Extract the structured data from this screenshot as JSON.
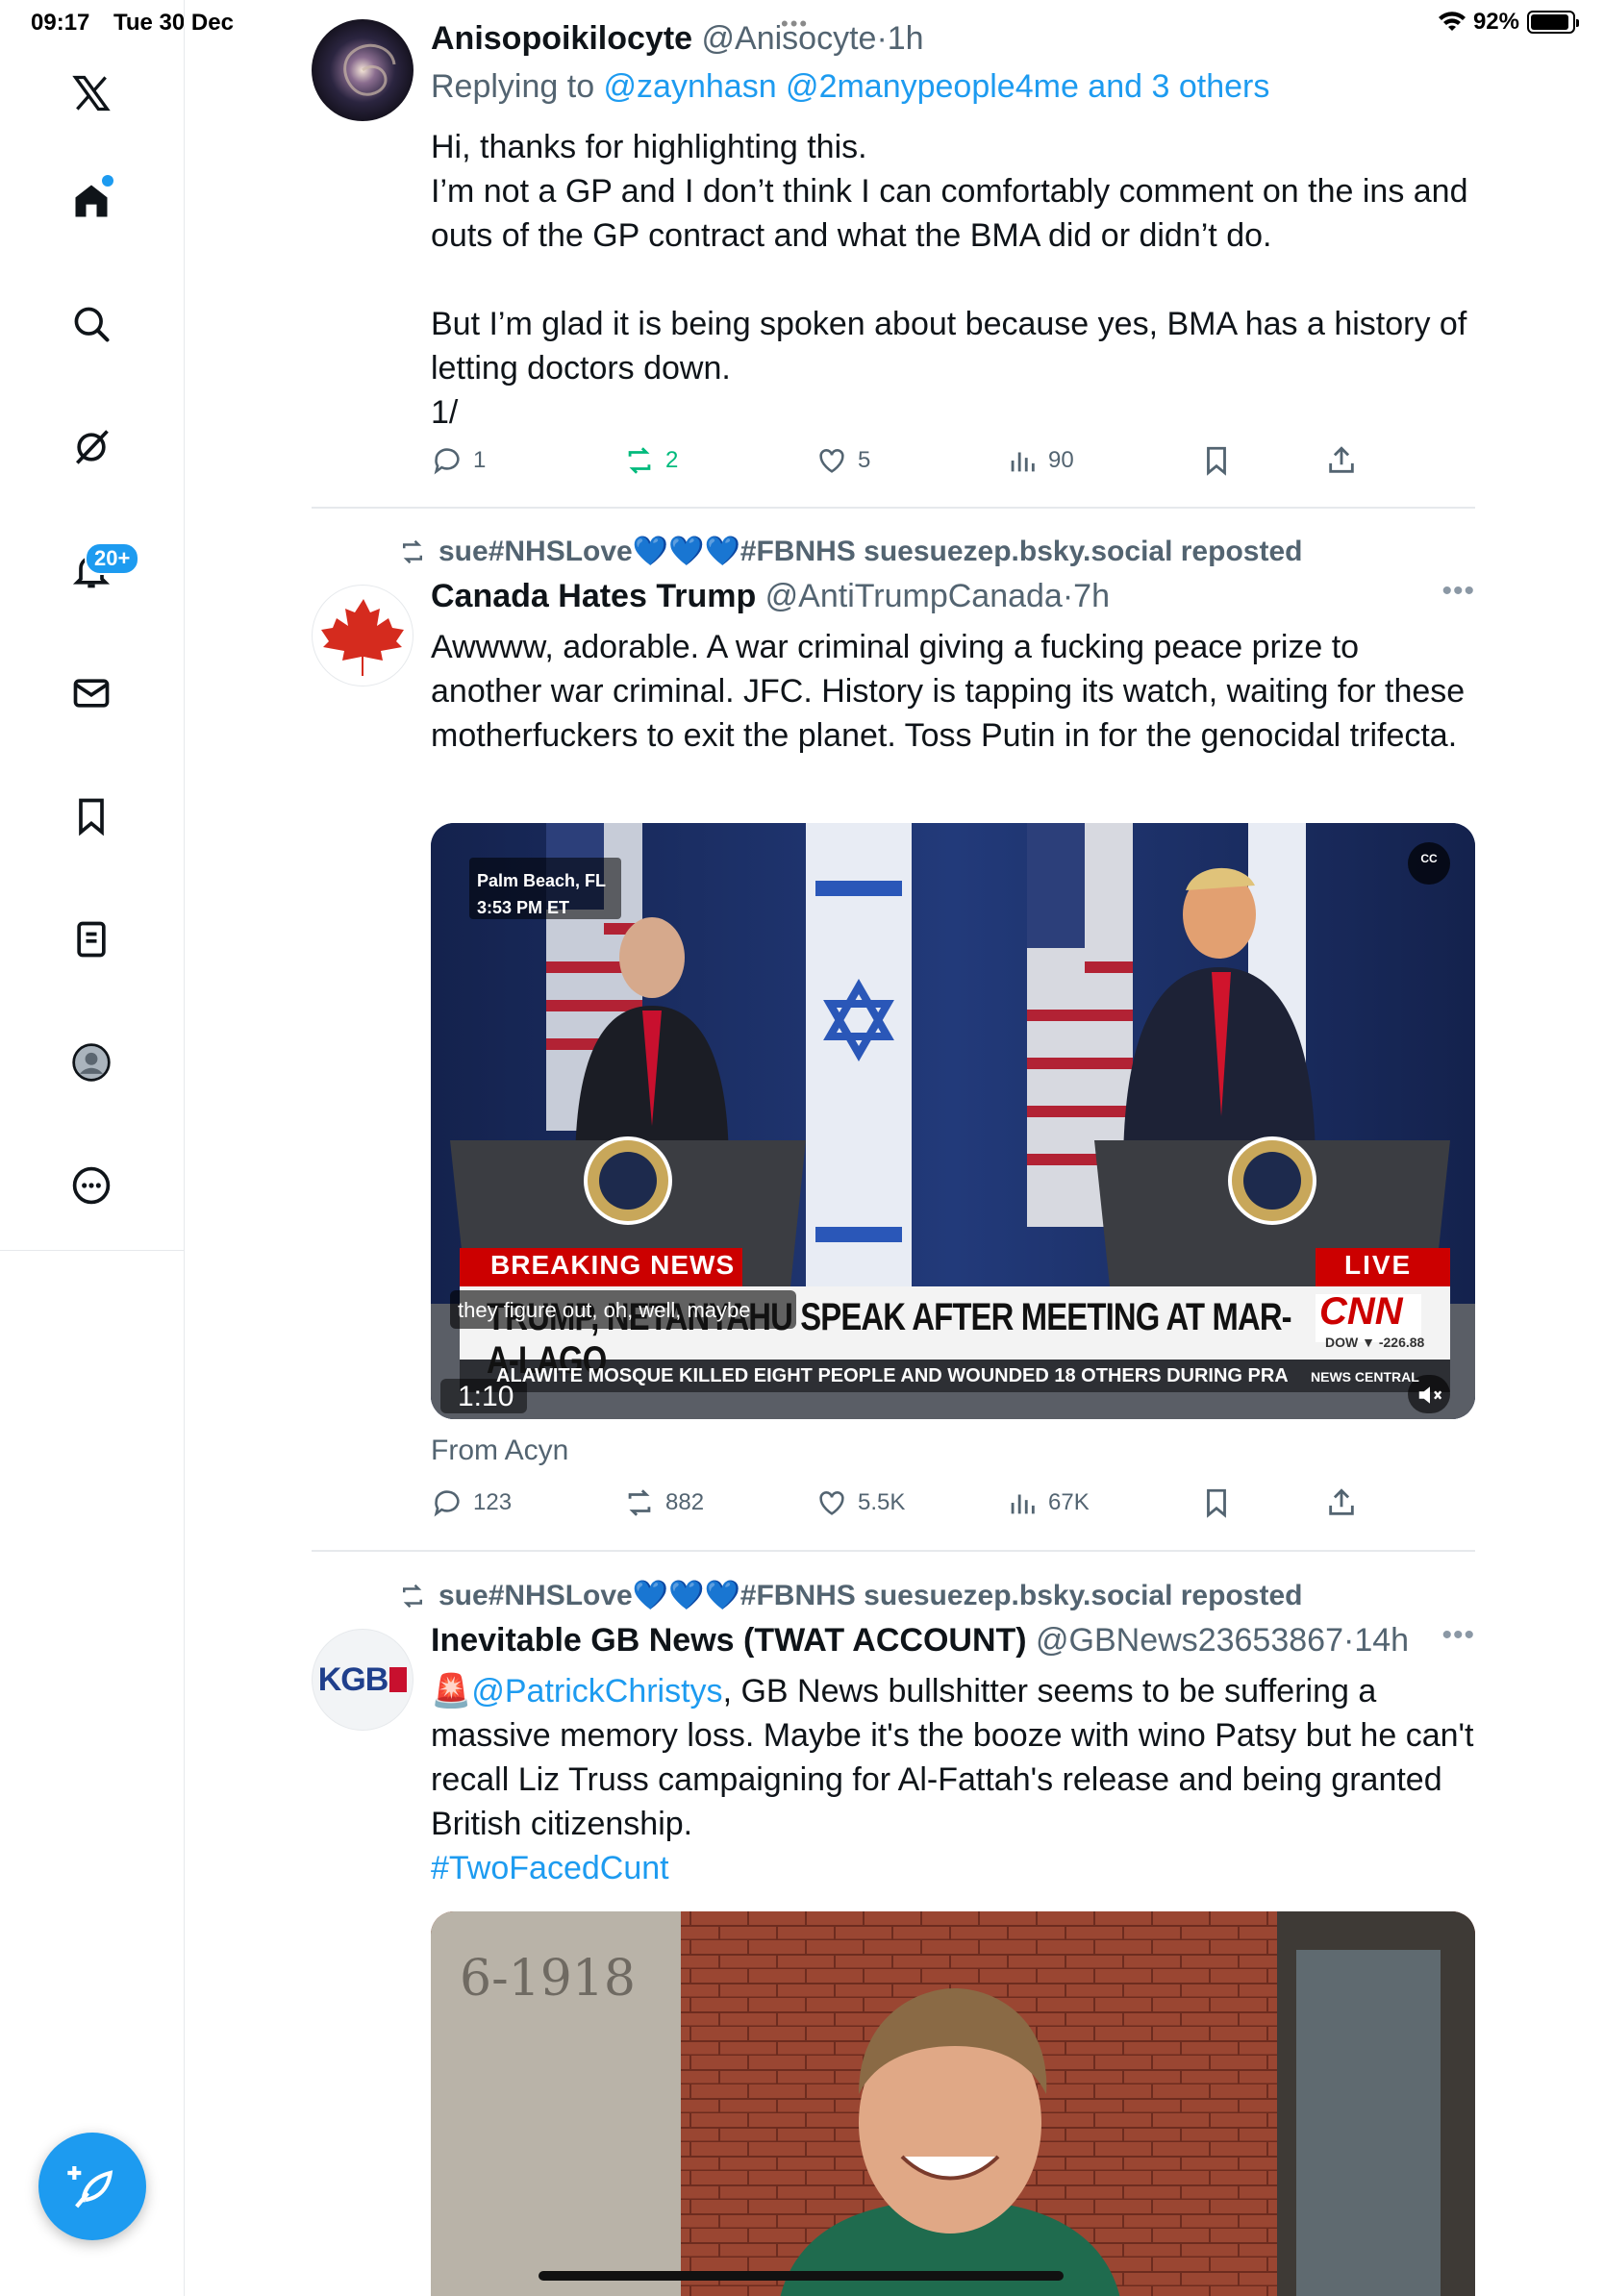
{
  "status_bar": {
    "time": "09:17",
    "date": "Tue 30 Dec",
    "battery": "92%"
  },
  "sidebar": {
    "items": [
      {
        "icon": "x-logo-icon"
      },
      {
        "icon": "home-icon"
      },
      {
        "icon": "search-icon"
      },
      {
        "icon": "grok-icon"
      },
      {
        "icon": "notifications-icon",
        "badge": "20+"
      },
      {
        "icon": "messages-icon"
      },
      {
        "icon": "bookmarks-icon"
      },
      {
        "icon": "lists-icon"
      },
      {
        "icon": "profile-icon"
      },
      {
        "icon": "more-icon"
      }
    ],
    "compose_icon": "compose-icon"
  },
  "tweets": [
    {
      "name": "Anisopoikilocyte",
      "handle": "@Anisocyte",
      "time": "1h",
      "replying_prefix": "Replying to ",
      "replying_to": "@zaynhasn @2manypeople4me and 3 others",
      "text": "Hi, thanks for highlighting this.\nI’m not a GP and I don’t think I can comfortably comment on the ins and outs of the GP contract and what the BMA did or didn’t do.\n\nBut I’m glad it is being spoken about because yes, BMA has a history of letting doctors down.\n1/",
      "replies": "1",
      "reposts": "2",
      "likes": "5",
      "views": "90"
    },
    {
      "repost_by": "sue#NHSLove💙💙💙#FBNHS suesuezep.bsky.social reposted",
      "name": "Canada Hates Trump",
      "handle": "@AntiTrumpCanada",
      "time": "7h",
      "text": "Awwww, adorable. A war criminal giving a fucking peace prize to another war criminal. JFC. History is tapping its watch, waiting for these motherfuckers to exit the planet.  Toss Putin in for the genocidal trifecta.",
      "video": {
        "location": "Palm Beach, FL",
        "clock": "3:53 PM ET",
        "breaking": "BREAKING NEWS",
        "live": "LIVE",
        "headline": "TRUMP, NETANYAHU SPEAK AFTER MEETING AT MAR-A-LAGO",
        "network": "CNN",
        "dow": "DOW ▼ -226.88",
        "ticker": "ALAWITE MOSQUE KILLED EIGHT PEOPLE AND WOUNDED 18 OTHERS DURING PRA",
        "ticker_tag": "NEWS CENTRAL",
        "caption": "they figure out, oh, well, maybe",
        "duration": "1:10",
        "cc": "CC"
      },
      "from": "From Acyn",
      "replies": "123",
      "reposts": "882",
      "likes": "5.5K",
      "views": "67K"
    },
    {
      "repost_by": "sue#NHSLove💙💙💙#FBNHS suesuezep.bsky.social reposted",
      "name": "Inevitable GB News (TWAT ACCOUNT)",
      "handle": "@GBNews23653867",
      "time": "14h",
      "avatar_text": "KGB",
      "mention_emoji": "🚨",
      "mention": "@PatrickChristys",
      "text": ", GB News bullshitter seems to be suffering a massive memory loss. Maybe it's the booze with wino Patsy but he can't recall Liz Truss campaigning for Al-Fattah's release and being granted British citizenship.",
      "hashtag": "#TwoFacedCunt",
      "photo_text": "6-1918"
    }
  ]
}
